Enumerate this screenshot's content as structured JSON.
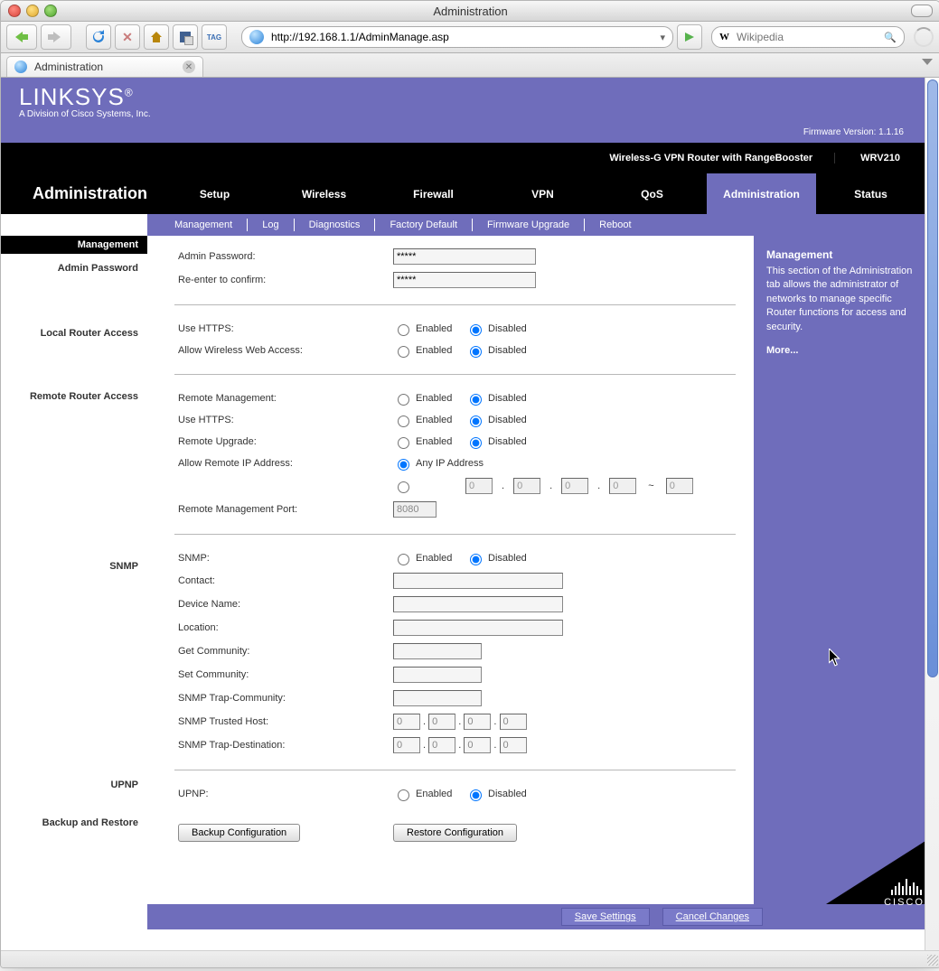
{
  "window": {
    "title": "Administration"
  },
  "browser": {
    "url": "http://192.168.1.1/AdminManage.asp",
    "search_placeholder": "Wikipedia",
    "tab_title": "Administration"
  },
  "linksys": {
    "logo": "LINKSYS",
    "logo_sub": "A Division of Cisco Systems, Inc.",
    "firmware": "Firmware Version: 1.1.16",
    "product_label": "Wireless-G VPN Router with RangeBooster",
    "model": "WRV210",
    "page_name": "Administration",
    "tabs": [
      "Setup",
      "Wireless",
      "Firewall",
      "VPN",
      "QoS",
      "Administration",
      "Status"
    ],
    "subtabs": [
      "Management",
      "Log",
      "Diagnostics",
      "Factory Default",
      "Firmware Upgrade",
      "Reboot"
    ]
  },
  "side": {
    "header": "Management",
    "s1": "Admin Password",
    "s2": "Local Router Access",
    "s3": "Remote Router Access",
    "s4": "SNMP",
    "s5": "UPNP",
    "s6": "Backup and Restore"
  },
  "form": {
    "admin_password_label": "Admin Password:",
    "reenter_label": "Re-enter to confirm:",
    "password_value": "*****",
    "use_https": "Use HTTPS:",
    "allow_wireless": "Allow Wireless Web Access:",
    "remote_mgmt": "Remote Management:",
    "remote_upgrade": "Remote Upgrade:",
    "allow_remote_ip": "Allow Remote IP Address:",
    "any_ip": "Any IP Address",
    "remote_port_label": "Remote Management Port:",
    "remote_port_value": "8080",
    "snmp": "SNMP:",
    "contact": "Contact:",
    "device_name": "Device Name:",
    "location": "Location:",
    "get_community": "Get Community:",
    "set_community": "Set Community:",
    "trap_community": "SNMP Trap-Community:",
    "trusted_host": "SNMP Trusted Host:",
    "trap_dest": "SNMP Trap-Destination:",
    "upnp": "UPNP:",
    "enabled": "Enabled",
    "disabled": "Disabled",
    "ip_octet": "0",
    "backup_btn": "Backup Configuration",
    "restore_btn": "Restore Configuration",
    "save": "Save Settings",
    "cancel": "Cancel Changes"
  },
  "help": {
    "title": "Management",
    "body": "This section of the Administration tab allows the administrator of networks to manage specific Router functions for access and security.",
    "more": "More..."
  },
  "cisco": "CISCO."
}
